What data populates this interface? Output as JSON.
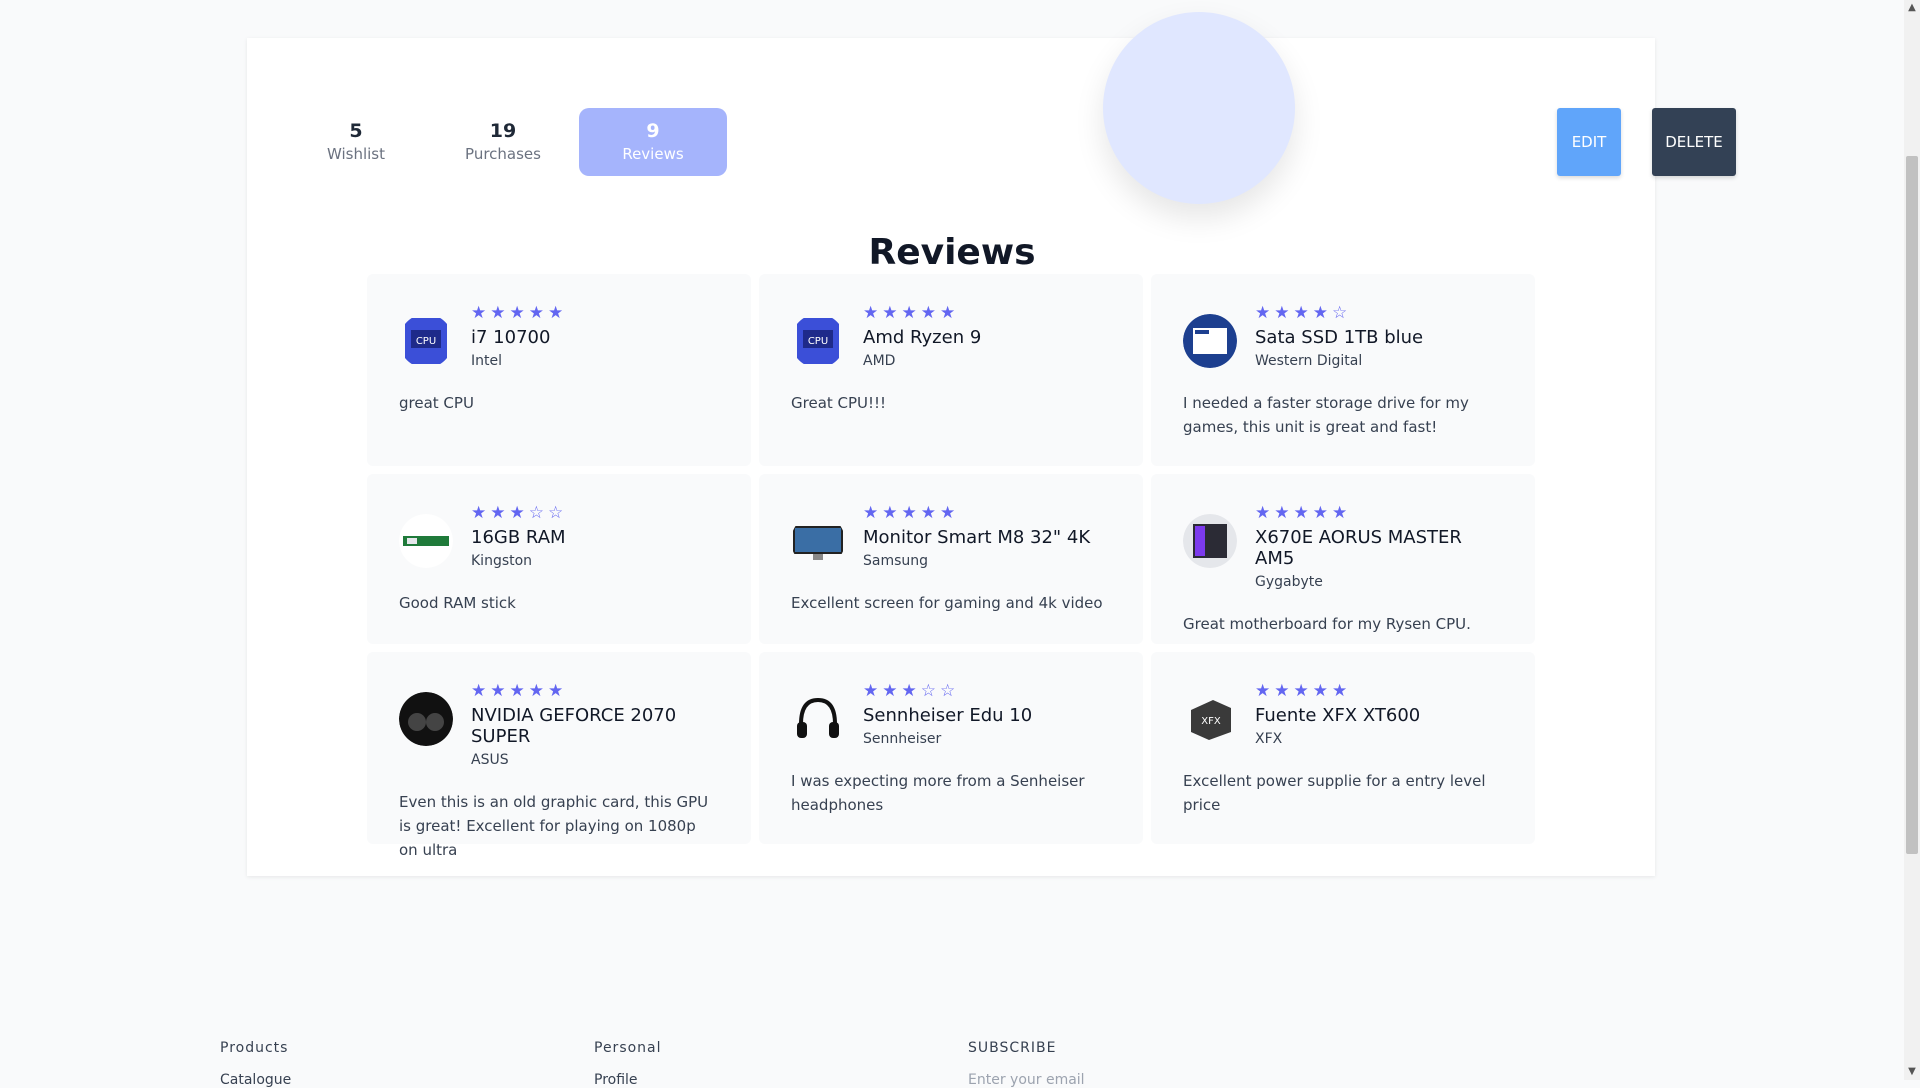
{
  "stats": [
    {
      "value": "5",
      "label": "Wishlist",
      "active": false
    },
    {
      "value": "19",
      "label": "Purchases",
      "active": false
    },
    {
      "value": "9",
      "label": "Reviews",
      "active": true
    }
  ],
  "actions": {
    "edit": "EDIT",
    "delete": "DELETE"
  },
  "section_title": "Reviews",
  "reviews": [
    {
      "rating": 5,
      "name": "i7 10700",
      "brand": "Intel",
      "text": "great CPU",
      "icon": "cpu-box-icon"
    },
    {
      "rating": 5,
      "name": "Amd Ryzen 9",
      "brand": "AMD",
      "text": "Great CPU!!!",
      "icon": "cpu-box-icon"
    },
    {
      "rating": 4,
      "name": "Sata SSD 1TB blue",
      "brand": "Western Digital",
      "text": "I needed a faster storage drive for my games, this unit is great and fast!",
      "icon": "ssd-icon"
    },
    {
      "rating": 3,
      "name": "16GB RAM",
      "brand": "Kingston",
      "text": "Good RAM stick",
      "icon": "ram-icon"
    },
    {
      "rating": 5,
      "name": "Monitor Smart M8 32\" 4K",
      "brand": "Samsung",
      "text": "Excellent screen for gaming and 4k video",
      "icon": "monitor-icon"
    },
    {
      "rating": 5,
      "name": "X670E AORUS MASTER AM5",
      "brand": "Gygabyte",
      "text": "Great motherboard for my Rysen CPU.",
      "icon": "motherboard-icon"
    },
    {
      "rating": 5,
      "name": "NVIDIA GEFORCE 2070 SUPER",
      "brand": "ASUS",
      "text": "Even this is an old graphic card, this GPU is great! Excellent for playing on 1080p on ultra",
      "icon": "gpu-icon"
    },
    {
      "rating": 3,
      "name": "Sennheiser Edu 10",
      "brand": "Sennheiser",
      "text": "I was expecting more from a Senheiser headphones",
      "icon": "headphones-icon"
    },
    {
      "rating": 5,
      "name": "Fuente XFX XT600",
      "brand": "XFX",
      "text": "Excellent power supplie for a entry level price",
      "icon": "psu-icon"
    }
  ],
  "footer": {
    "columns": [
      "Products",
      "Personal",
      "SUBSCRIBE"
    ],
    "links": [
      "Catalogue",
      "Profile",
      "Enter your email"
    ]
  },
  "colors": {
    "accent": "#6366f1",
    "active_stat": "#a5b4fc",
    "edit": "#60a5fa",
    "delete": "#334155"
  }
}
